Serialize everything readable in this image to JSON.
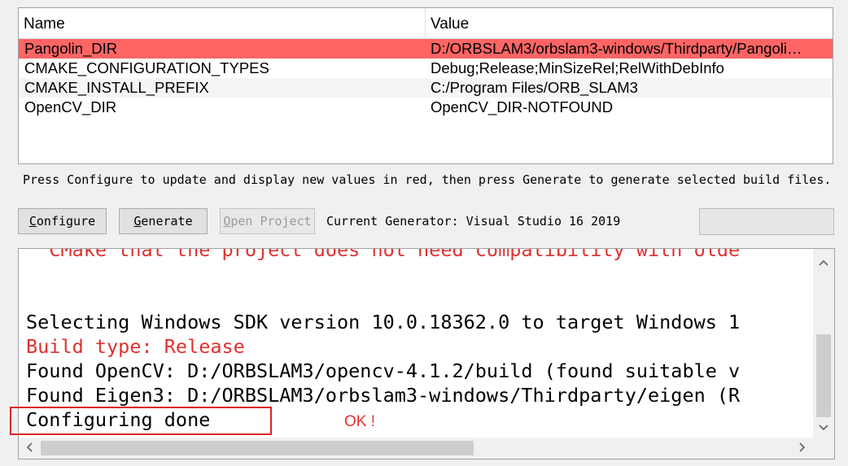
{
  "cache_table": {
    "headers": {
      "name": "Name",
      "value": "Value"
    },
    "rows": [
      {
        "name": "Pangolin_DIR",
        "value": "D:/ORBSLAM3/orbslam3-windows/Thirdparty/Pangoli…",
        "state": "new"
      },
      {
        "name": "CMAKE_CONFIGURATION_TYPES",
        "value": "Debug;Release;MinSizeRel;RelWithDebInfo",
        "state": "normal"
      },
      {
        "name": "CMAKE_INSTALL_PREFIX",
        "value": "C:/Program Files/ORB_SLAM3",
        "state": "normal"
      },
      {
        "name": "OpenCV_DIR",
        "value": "OpenCV_DIR-NOTFOUND",
        "state": "normal"
      }
    ]
  },
  "hint": "Press Configure to update and display new values in red, then press Generate to generate selected build files.",
  "buttons": {
    "configure": {
      "first": "C",
      "rest": "onfigure"
    },
    "generate": {
      "first": "G",
      "rest": "enerate"
    },
    "open_project": {
      "first": "O",
      "rest": "pen Project"
    }
  },
  "generator_label": "Current Generator: Visual Studio 16 2019",
  "output": {
    "lines": [
      {
        "text": "  CMake that the project does not need compatibility with olde",
        "color": "red"
      },
      {
        "text": "Selecting Windows SDK version 10.0.18362.0 to target Windows 1",
        "color": "black"
      },
      {
        "text": "Build type: Release",
        "color": "red"
      },
      {
        "text": "Found OpenCV: D:/ORBSLAM3/opencv-4.1.2/build (found suitable v",
        "color": "black"
      },
      {
        "text": "Found Eigen3: D:/ORBSLAM3/orbslam3-windows/Thirdparty/eigen (R",
        "color": "black"
      },
      {
        "text": "Configuring done",
        "color": "black"
      }
    ]
  },
  "annotation": {
    "text": "OK !"
  },
  "icons": {
    "scroll_up": "chevron-up-icon",
    "scroll_down": "chevron-down-icon",
    "scroll_left": "chevron-left-icon",
    "scroll_right": "chevron-right-icon"
  },
  "colors": {
    "new_row": "#ff6565",
    "error_text": "#e03131",
    "annotation": "#e02020"
  }
}
